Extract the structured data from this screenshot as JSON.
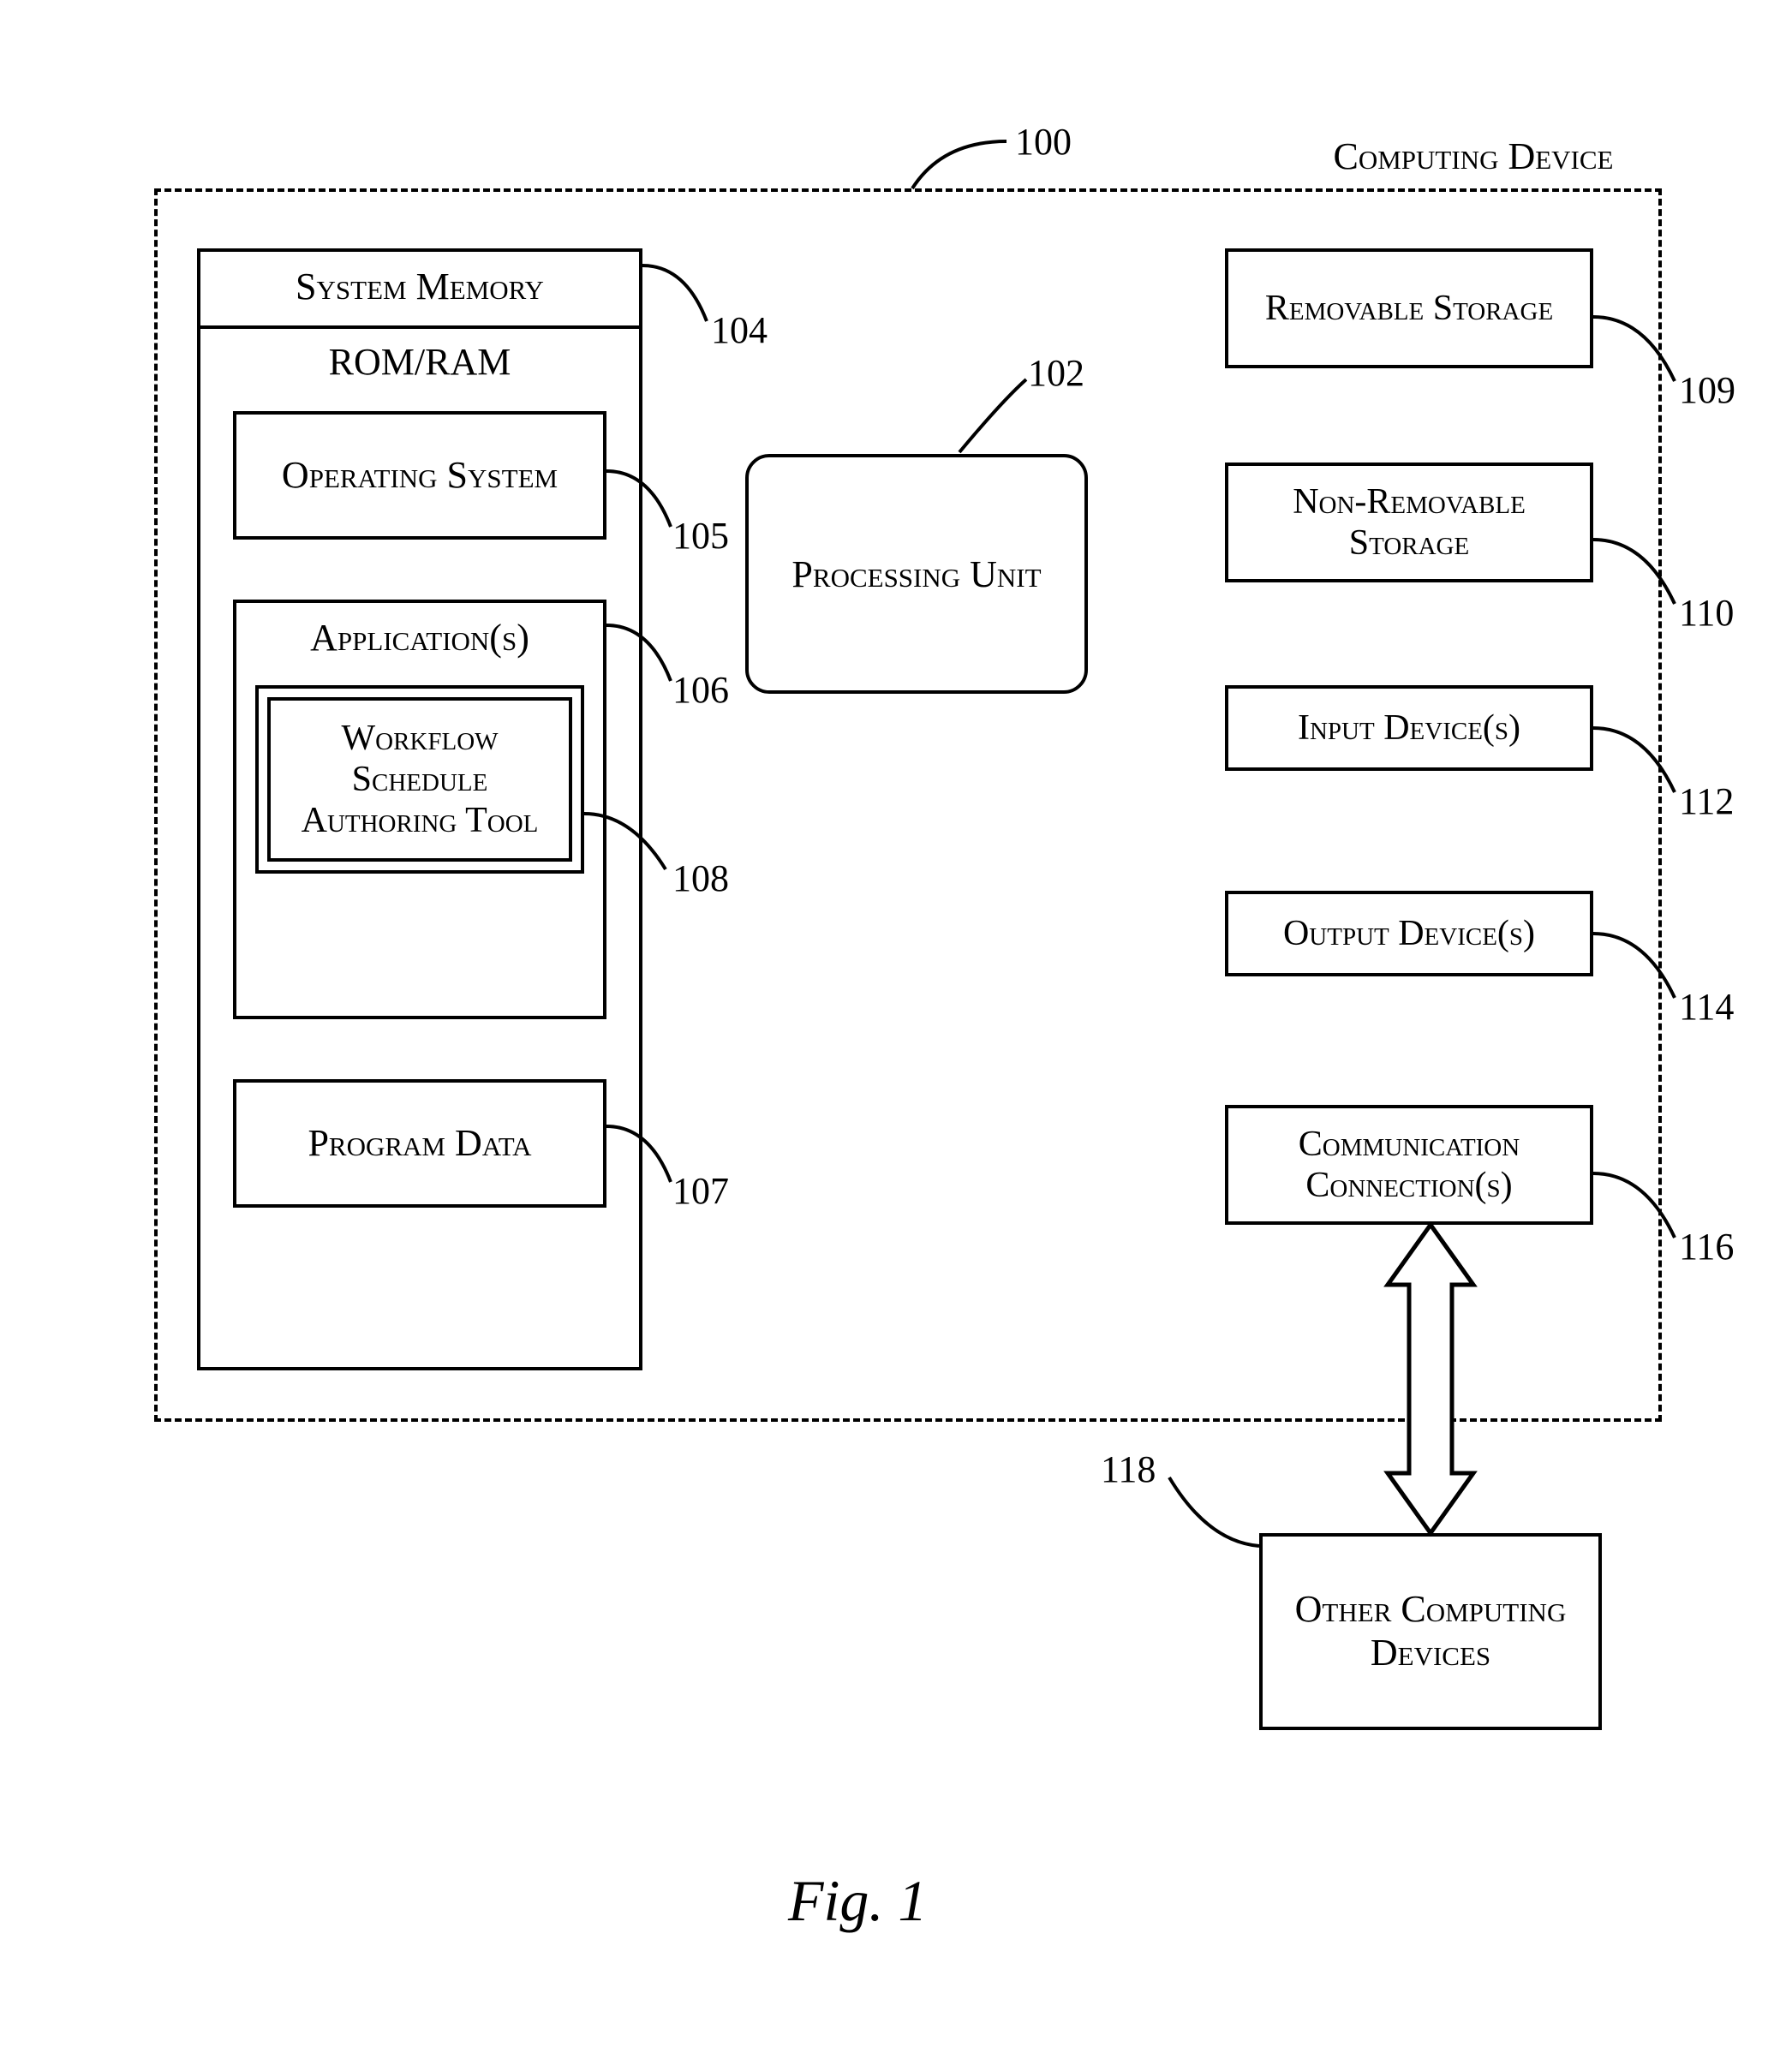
{
  "title": "Computing Device",
  "figure_caption": "Fig. 1",
  "refs": {
    "device": "100",
    "processing_unit": "102",
    "system_memory": "104",
    "operating_system": "105",
    "applications": "106",
    "program_data": "107",
    "workflow_tool": "108",
    "removable_storage": "109",
    "non_removable_storage": "110",
    "input_devices": "112",
    "output_devices": "114",
    "communication": "116",
    "other_devices": "118"
  },
  "blocks": {
    "system_memory": "System Memory",
    "rom_ram": "ROM/RAM",
    "operating_system": "Operating System",
    "applications": "Application(s)",
    "workflow_tool": "Workflow Schedule Authoring Tool",
    "program_data": "Program Data",
    "processing_unit": "Processing Unit",
    "removable_storage": "Removable Storage",
    "non_removable_storage": "Non-Removable Storage",
    "input_devices": "Input Device(s)",
    "output_devices": "Output Device(s)",
    "communication": "Communication Connection(s)",
    "other_devices": "Other Computing Devices"
  }
}
